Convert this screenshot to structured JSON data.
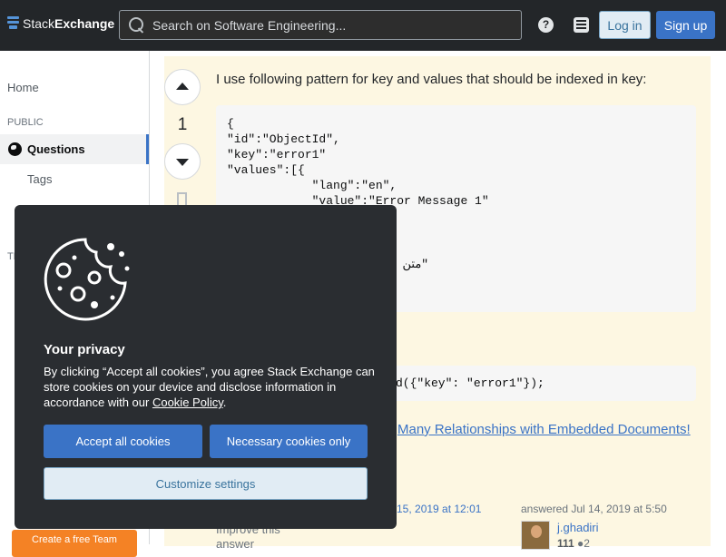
{
  "header": {
    "logo_prefix": "Stack",
    "logo_bold": "Exchange",
    "search_placeholder": "Search on Software Engineering...",
    "help_glyph": "?",
    "login_label": "Log in",
    "signup_label": "Sign up"
  },
  "sidebar": {
    "home": "Home",
    "section_public": "PUBLIC",
    "questions": "Questions",
    "tags": "Tags",
    "teams_prefix": "TE",
    "create_team": "Create a free Team"
  },
  "post": {
    "vote_count": "1",
    "intro": "I use following pattern for key and values that should be indexed in key:",
    "code_block": "{\n\"id\":\"ObjectId\",\n\"key\":\"error1\"\n\"values\":[{\n            \"lang\":\"en\",\n            \"value\":\"Error Message 1\"",
    "code_tail": "متن خطای شماره 1\"",
    "code_query": "d({\"key\": \"error1\"});",
    "link_text": "Many Relationships with Embedded Documents!",
    "edited_timestamp": "15, 2019 at 12:01",
    "improve_text": "Improve this answer",
    "answered_label": "answered Jul 14, 2019 at 5:50",
    "username": "j.ghadiri",
    "reputation": "111",
    "badge_count": "2"
  },
  "cookie_banner": {
    "title": "Your privacy",
    "text": "By clicking “Accept all cookies”, you agree Stack Exchange can store cookies on your device and disclose information in accordance with our ",
    "link": "Cookie Policy",
    "text_end": ".",
    "accept_label": "Accept all cookies",
    "necessary_label": "Necessary cookies only",
    "customize_label": "Customize settings"
  },
  "colors": {
    "topbar": "#232629",
    "brand_blue": "#3a73c6",
    "post_highlight": "#fdf7e2",
    "cookie_bg": "#2a2d31",
    "orange": "#f48225"
  }
}
